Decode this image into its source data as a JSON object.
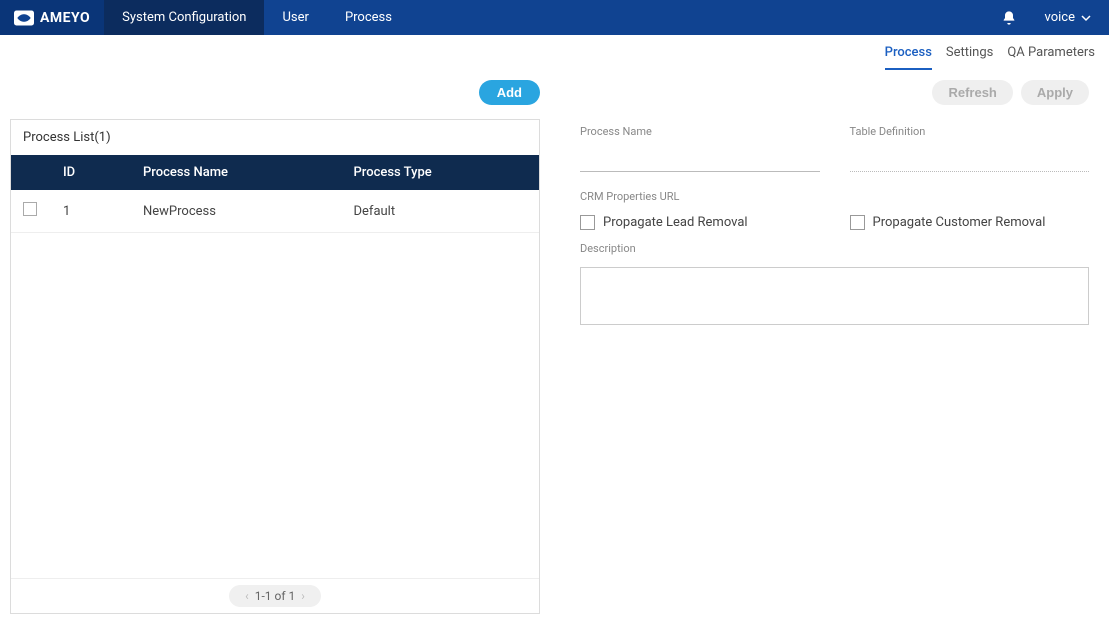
{
  "brand": "AMEYO",
  "topnav": {
    "items": [
      "System Configuration",
      "User",
      "Process"
    ],
    "active_index": 0
  },
  "user_menu": {
    "label": "voice"
  },
  "subtabs": {
    "items": [
      "Process",
      "Settings",
      "QA Parameters"
    ],
    "active_index": 0
  },
  "add_button": "Add",
  "list": {
    "title": "Process List(1)",
    "columns": [
      "ID",
      "Process Name",
      "Process Type"
    ],
    "rows": [
      {
        "id": "1",
        "name": "NewProcess",
        "type": "Default"
      }
    ],
    "pagination": "1-1 of 1"
  },
  "actions": {
    "refresh": "Refresh",
    "apply": "Apply"
  },
  "form": {
    "process_name_label": "Process Name",
    "process_name_value": "",
    "table_definition_label": "Table Definition",
    "table_definition_value": "",
    "crm_label": "CRM Properties URL",
    "crm_value": "",
    "check_lead": "Propagate Lead Removal",
    "check_customer": "Propagate Customer Removal",
    "description_label": "Description",
    "description_value": ""
  }
}
